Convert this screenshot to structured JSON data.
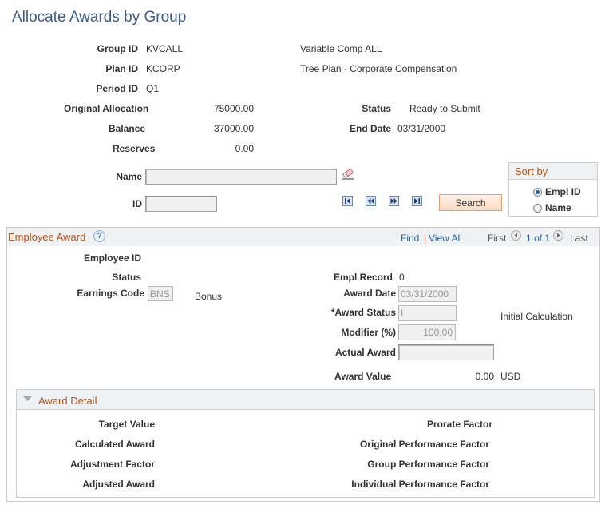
{
  "page": {
    "title": "Allocate Awards by Group"
  },
  "header_fields": {
    "group_id": {
      "label": "Group ID",
      "value": "KVCALL",
      "description": "Variable Comp ALL"
    },
    "plan_id": {
      "label": "Plan ID",
      "value": "KCORP",
      "description": "Tree Plan - Corporate Compensation"
    },
    "period_id": {
      "label": "Period ID",
      "value": "Q1"
    },
    "original_allocation": {
      "label": "Original Allocation",
      "value": "75000.00"
    },
    "balance": {
      "label": "Balance",
      "value": "37000.00"
    },
    "reserves": {
      "label": "Reserves",
      "value": "0.00"
    },
    "status": {
      "label": "Status",
      "value": "Ready to Submit"
    },
    "end_date": {
      "label": "End Date",
      "value": "03/31/2000"
    }
  },
  "search": {
    "name_label": "Name",
    "name_value": "",
    "id_label": "ID",
    "id_value": "",
    "clear_icon": "eraser-icon",
    "nav_buttons": [
      "first-record-icon",
      "previous-record-icon",
      "next-record-icon",
      "last-record-icon"
    ],
    "search_button": "Search"
  },
  "sort_by": {
    "title": "Sort by",
    "options": [
      {
        "label": "Empl ID",
        "selected": true
      },
      {
        "label": "Name",
        "selected": false
      }
    ]
  },
  "employee_award": {
    "title": "Employee Award",
    "help_icon": "?",
    "find": "Find",
    "separator": "|",
    "view_all": "View All",
    "first": "First",
    "pagination": "1 of 1",
    "last": "Last",
    "fields": {
      "employee_id": {
        "label": "Employee ID",
        "value": ""
      },
      "status": {
        "label": "Status",
        "value": ""
      },
      "earnings_code": {
        "label": "Earnings Code",
        "value": "BNS",
        "description": "Bonus"
      },
      "empl_record": {
        "label": "Empl Record",
        "value": "0"
      },
      "award_date": {
        "label": "Award Date",
        "value": "03/31/2000"
      },
      "award_status": {
        "label": "*Award Status",
        "value": "I",
        "description": "Initial Calculation"
      },
      "modifier": {
        "label": "Modifier (%)",
        "value": "100.00"
      },
      "actual_award": {
        "label": "Actual Award",
        "value": ""
      },
      "award_value": {
        "label": "Award Value",
        "value": "0.00",
        "currency": "USD"
      }
    }
  },
  "award_detail": {
    "title": "Award Detail",
    "left_labels": [
      "Target Value",
      "Calculated Award",
      "Adjustment Factor",
      "Adjusted Award"
    ],
    "right_labels": [
      "Prorate Factor",
      "Original Performance Factor",
      "Group Performance Factor",
      "Individual Performance Factor"
    ]
  }
}
